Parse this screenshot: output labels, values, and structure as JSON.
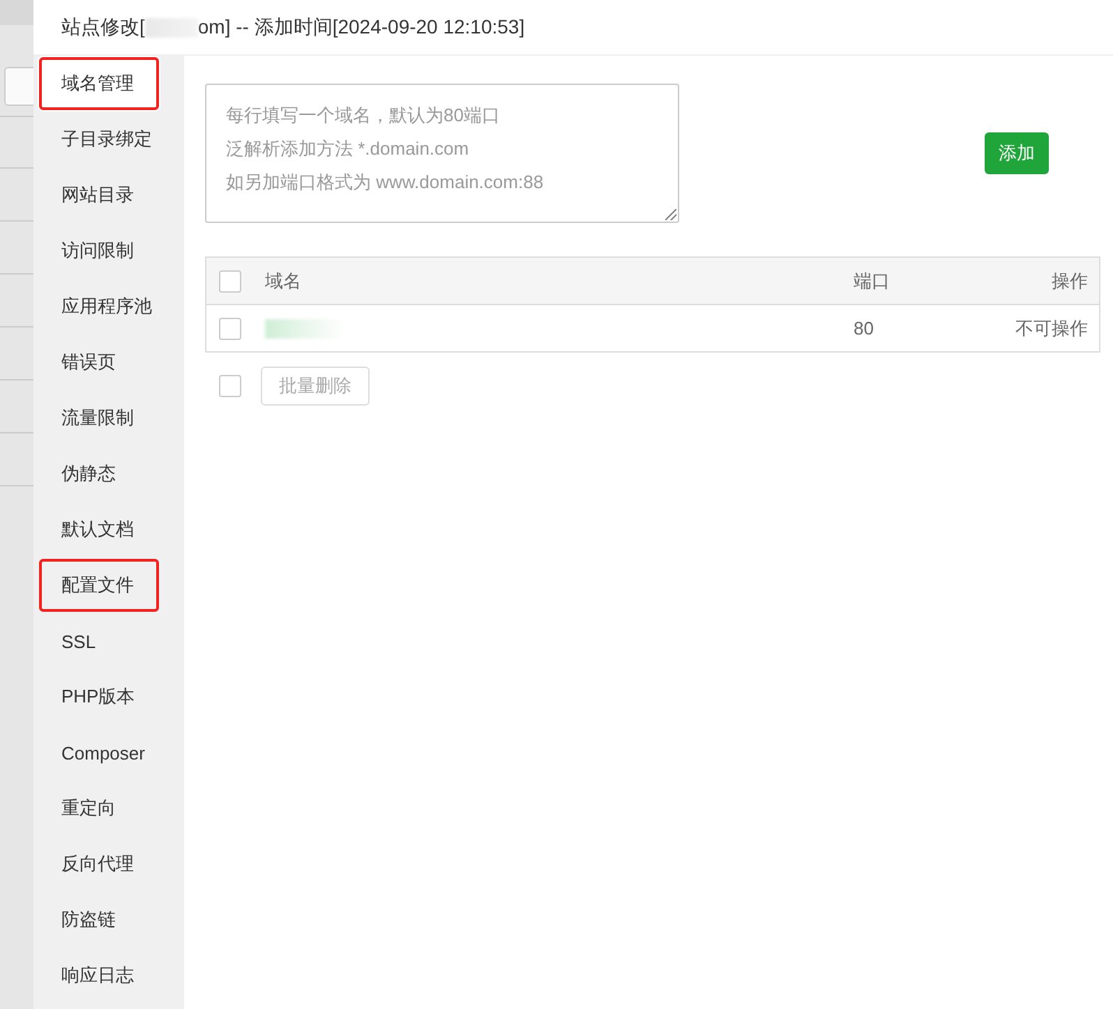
{
  "window": {
    "title_before": "站点修改[",
    "title_after": "om] -- 添加时间[2024-09-20 12:10:53]"
  },
  "sidebar": {
    "items": [
      {
        "label": "域名管理",
        "selected": true,
        "annotated": true
      },
      {
        "label": "子目录绑定",
        "selected": false,
        "annotated": false
      },
      {
        "label": "网站目录",
        "selected": false,
        "annotated": false
      },
      {
        "label": "访问限制",
        "selected": false,
        "annotated": false
      },
      {
        "label": "应用程序池",
        "selected": false,
        "annotated": false
      },
      {
        "label": "错误页",
        "selected": false,
        "annotated": false
      },
      {
        "label": "流量限制",
        "selected": false,
        "annotated": false
      },
      {
        "label": "伪静态",
        "selected": false,
        "annotated": false
      },
      {
        "label": "默认文档",
        "selected": false,
        "annotated": false
      },
      {
        "label": "配置文件",
        "selected": false,
        "annotated": true
      },
      {
        "label": "SSL",
        "selected": false,
        "annotated": false
      },
      {
        "label": "PHP版本",
        "selected": false,
        "annotated": false
      },
      {
        "label": "Composer",
        "selected": false,
        "annotated": false
      },
      {
        "label": "重定向",
        "selected": false,
        "annotated": false
      },
      {
        "label": "反向代理",
        "selected": false,
        "annotated": false
      },
      {
        "label": "防盗链",
        "selected": false,
        "annotated": false
      },
      {
        "label": "响应日志",
        "selected": false,
        "annotated": false
      }
    ]
  },
  "domain_input": {
    "placeholder_lines": [
      "每行填写一个域名，默认为80端口",
      "泛解析添加方法 *.domain.com",
      "如另加端口格式为 www.domain.com:88"
    ]
  },
  "add_button": "添加",
  "table": {
    "columns": [
      "域名",
      "端口",
      "操作"
    ],
    "header_checked": false,
    "rows": [
      {
        "checked": false,
        "port": "80",
        "action": "不可操作"
      }
    ]
  },
  "footer": {
    "checked": false,
    "batch_delete": {
      "label": "批量删除",
      "disabled": true
    }
  }
}
